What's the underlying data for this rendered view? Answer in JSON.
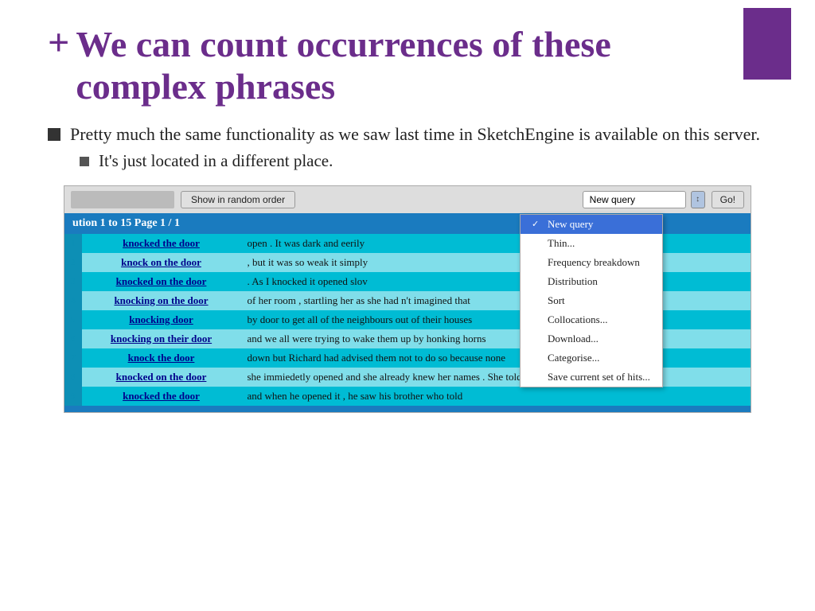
{
  "slide": {
    "plus_sign": "+",
    "title_line1": "We can count occurrences of these",
    "title_line2": "complex phrases",
    "bullet1": "Pretty much the same functionality as we saw last time in SketchEngine is available on this server.",
    "sub_bullet1": "It's just located in a different place.",
    "purple_bar_visible": true
  },
  "toolbar": {
    "random_button": "Show in random order",
    "query_label": "New query",
    "go_button": "Go!",
    "query_placeholder": "New query"
  },
  "dropdown": {
    "items": [
      {
        "label": "New query",
        "active": true,
        "checked": true
      },
      {
        "label": "Thin...",
        "active": false,
        "checked": false
      },
      {
        "label": "Frequency breakdown",
        "active": false,
        "checked": false
      },
      {
        "label": "Distribution",
        "active": false,
        "checked": false
      },
      {
        "label": "Sort",
        "active": false,
        "checked": false
      },
      {
        "label": "Collocations...",
        "active": false,
        "checked": false
      },
      {
        "label": "Download...",
        "active": false,
        "checked": false
      },
      {
        "label": "Categorise...",
        "active": false,
        "checked": false
      },
      {
        "label": "Save current set of hits...",
        "active": false,
        "checked": false
      }
    ]
  },
  "results_header": "ution 1 to 15     Page 1 / 1",
  "rows": [
    {
      "phrase": "knocked the door",
      "context": "open . It was dark and eerily"
    },
    {
      "phrase": "knock on the door",
      "context": ", but it was so weak it simply"
    },
    {
      "phrase": "knocked on the door",
      "context": ". As I knocked it opened slov"
    },
    {
      "phrase": "knocking on the door",
      "context": "of her room , startling her as she had n't imagined that"
    },
    {
      "phrase": "knocking door",
      "context": "by door to get all of the neighbours out of their houses"
    },
    {
      "phrase": "knocking on their door",
      "context": "and we all were trying to wake them up by honking horns"
    },
    {
      "phrase": "knock the door",
      "context": "down but Richard had advised them not to do so because none"
    },
    {
      "phrase": "knocked on the door",
      "context": "she immiedetly opened and she already knew her names . She told"
    },
    {
      "phrase": "knocked the door",
      "context": "and when he opened it , he saw his brother who told"
    }
  ]
}
